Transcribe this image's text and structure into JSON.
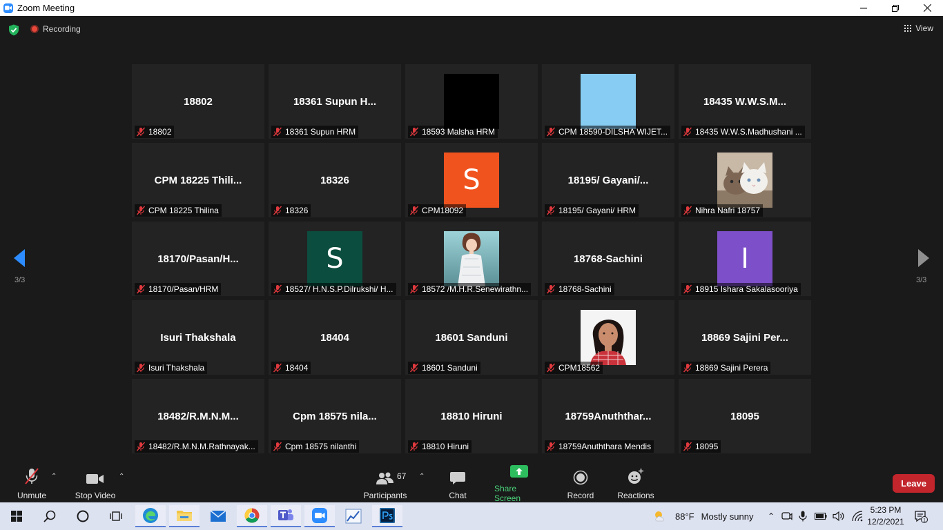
{
  "window": {
    "title": "Zoom Meeting"
  },
  "topbar": {
    "recording_label": "Recording",
    "view_label": "View"
  },
  "gallery": {
    "page_left": "3/3",
    "page_right": "3/3",
    "tiles": [
      {
        "center": "18802",
        "label": "18802"
      },
      {
        "center": "18361 Supun H...",
        "label": "18361 Supun HRM"
      },
      {
        "avatar": "black",
        "label": "18593 Malsha HRM"
      },
      {
        "avatar": "lightblue",
        "label": "CPM 18590-DILSHA WIJET..."
      },
      {
        "center": "18435 W.W.S.M...",
        "label": "18435 W.W.S.Madhushani ..."
      },
      {
        "center": "CPM 18225 Thili...",
        "label": "CPM 18225 Thilina"
      },
      {
        "center": "18326",
        "label": "18326"
      },
      {
        "avatar_letter": "S",
        "avatar_color": "#f1531f",
        "label": "CPM18092"
      },
      {
        "center": "18195/ Gayani/...",
        "label": "18195/ Gayani/ HRM"
      },
      {
        "avatar": "kittens-photo",
        "label": "Nihra Nafri 18757"
      },
      {
        "center": "18170/Pasan/H...",
        "label": "18170/Pasan/HRM"
      },
      {
        "avatar_letter": "S",
        "avatar_color": "#0b4d3e",
        "label": "18527/ H.N.S.P.Dilrukshi/ H..."
      },
      {
        "avatar": "girl-illustration",
        "label": "18572 /M.H.R.Senewirathn..."
      },
      {
        "center": "18768-Sachini",
        "label": "18768-Sachini"
      },
      {
        "avatar_letter": "I",
        "avatar_color": "#7d4fc8",
        "label": "18915 Ishara Sakalasooriya"
      },
      {
        "center": "Isuri Thakshala",
        "label": "Isuri Thakshala"
      },
      {
        "center": "18404",
        "label": "18404"
      },
      {
        "center": "18601 Sanduni",
        "label": "18601 Sanduni"
      },
      {
        "avatar": "profile-photo",
        "label": "CPM18562"
      },
      {
        "center": "18869 Sajini Per...",
        "label": "18869 Sajini Perera"
      },
      {
        "center": "18482/R.M.N.M...",
        "label": "18482/R.M.N.M.Rathnayak..."
      },
      {
        "center": "Cpm 18575 nila...",
        "label": "Cpm 18575 nilanthi"
      },
      {
        "center": "18810 Hiruni",
        "label": "18810 Hiruni"
      },
      {
        "center": "18759Anuththar...",
        "label": "18759Anuththara Mendis"
      },
      {
        "center": "18095",
        "label": "18095"
      }
    ]
  },
  "toolbar": {
    "unmute": "Unmute",
    "stop_video": "Stop Video",
    "participants": "Participants",
    "participants_count": "67",
    "chat": "Chat",
    "share_screen": "Share Screen",
    "record": "Record",
    "reactions": "Reactions",
    "leave": "Leave"
  },
  "taskbar": {
    "temperature": "88°F",
    "weather": "Mostly sunny",
    "time": "5:23 PM",
    "date": "12/2/2021",
    "notifications_count": "1"
  },
  "colors": {
    "leave": "#c3252c",
    "share_green": "#4bd37b",
    "arrow_blue": "#2d8cff"
  }
}
